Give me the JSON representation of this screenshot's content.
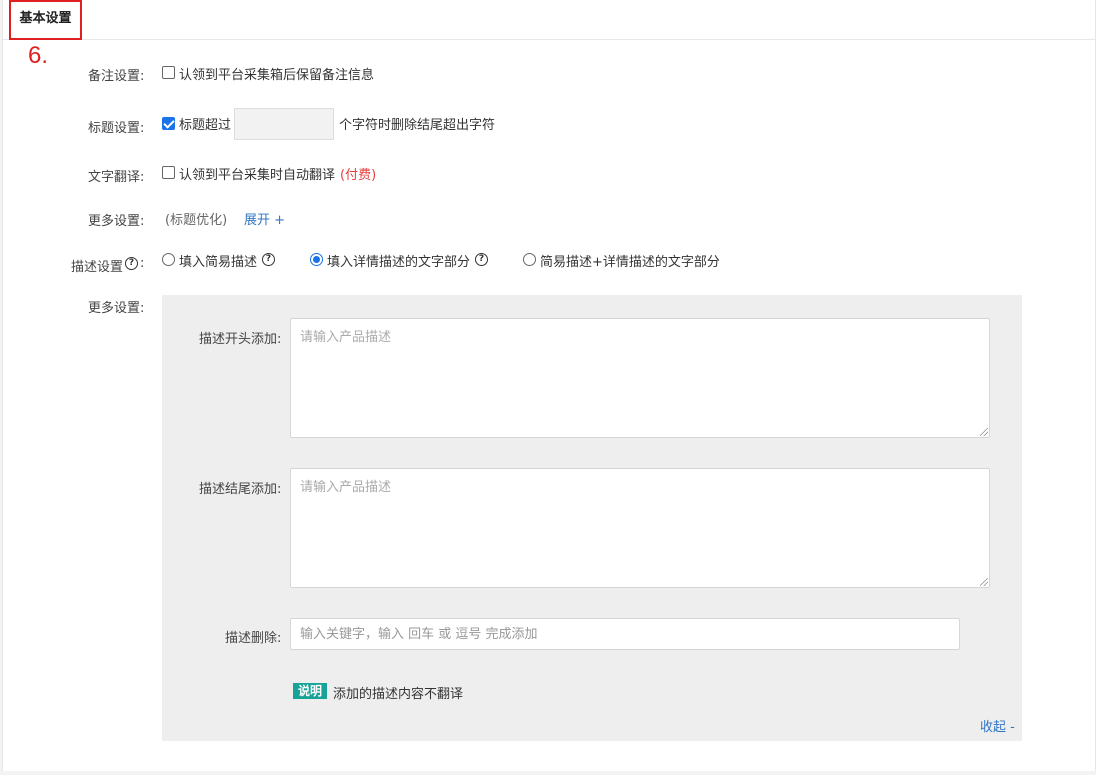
{
  "header": {
    "title": "基本设置",
    "step": "6."
  },
  "remark": {
    "label": "备注设置:",
    "option": "认领到平台采集箱后保留备注信息",
    "checked": false
  },
  "title_setting": {
    "label": "标题设置:",
    "option": "标题超过",
    "checked": true,
    "value": "",
    "suffix": "个字符时删除结尾超出字符"
  },
  "translate": {
    "label": "文字翻译:",
    "option": "认领到平台采集时自动翻译",
    "paid": "(付费)",
    "checked": false
  },
  "more1": {
    "label": "更多设置:",
    "value": "(标题优化)",
    "expand": "展开 +"
  },
  "desc": {
    "label": "描述设置",
    "colon": ":",
    "options": [
      "填入简易描述",
      "填入详情描述的文字部分",
      "简易描述+详情描述的文字部分"
    ],
    "selected": 1
  },
  "more2": {
    "label": "更多设置:",
    "head_label": "描述开头添加:",
    "head_placeholder": "请输入产品描述",
    "tail_label": "描述结尾添加:",
    "tail_placeholder": "请输入产品描述",
    "del_label": "描述删除:",
    "del_placeholder": "输入关键字，输入 回车 或 逗号 完成添加",
    "note_badge": "说明",
    "note_text": "添加的描述内容不翻译",
    "collapse": "收起 -"
  },
  "colors": {
    "accent": "#1a73e8",
    "link": "#3276c3",
    "paid": "#e84040",
    "badge": "#17a398",
    "highlight": "#e02020"
  },
  "icons": {
    "help": "question-circle-icon",
    "resize": "resize-grip-icon"
  }
}
